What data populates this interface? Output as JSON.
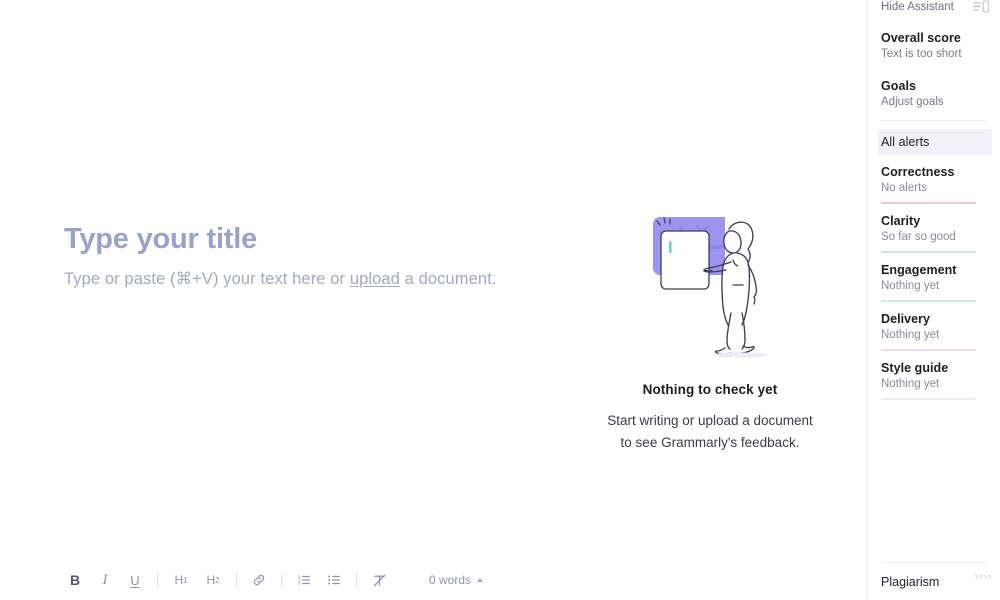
{
  "editor": {
    "title_placeholder": "Type your title",
    "body_placeholder_before": "Type or paste (⌘+V) your text here or ",
    "body_upload_link": "upload",
    "body_placeholder_after": " a document."
  },
  "empty_state": {
    "illustration_name": "woman-pointing-at-document-illustration",
    "title": "Nothing to check yet",
    "line1": "Start writing or upload a document",
    "line2": "to see Grammarly's feedback."
  },
  "toolbar": {
    "buttons": [
      {
        "name": "bold-button",
        "label": "B"
      },
      {
        "name": "italic-button",
        "label": "I"
      },
      {
        "name": "underline-button",
        "label": "U"
      },
      {
        "name": "heading-1-button",
        "label": "H",
        "sub": "1"
      },
      {
        "name": "heading-2-button",
        "label": "H",
        "sub": "2"
      },
      {
        "name": "link-button",
        "label": "link-icon"
      },
      {
        "name": "ordered-list-button",
        "label": "ordered-list-icon"
      },
      {
        "name": "bullet-list-button",
        "label": "bullet-list-icon"
      },
      {
        "name": "clear-formatting-button",
        "label": "clear-formatting-icon"
      }
    ],
    "word_count": "0 words"
  },
  "assistant": {
    "hide_label": "Hide Assistant",
    "panel_icon": "panel-toggle-icon",
    "overall_score": {
      "heading": "Overall score",
      "status": "Text is too short"
    },
    "goals": {
      "heading": "Goals",
      "status": "Adjust goals"
    },
    "all_alerts_label": "All alerts",
    "categories": [
      {
        "name": "Correctness",
        "status": "No alerts",
        "color": "#f5c9d2"
      },
      {
        "name": "Clarity",
        "status": "So far so good",
        "color": "#cfe0f2"
      },
      {
        "name": "Engagement",
        "status": "Nothing yet",
        "color": "#cfeee3"
      },
      {
        "name": "Delivery",
        "status": "Nothing yet",
        "color": "#e9dcf2"
      },
      {
        "name": "Style guide",
        "status": "Nothing yet",
        "color": "#ececf1"
      }
    ],
    "plagiarism": {
      "label": "Plagiarism",
      "icon": "quotation-mark-icon"
    }
  }
}
